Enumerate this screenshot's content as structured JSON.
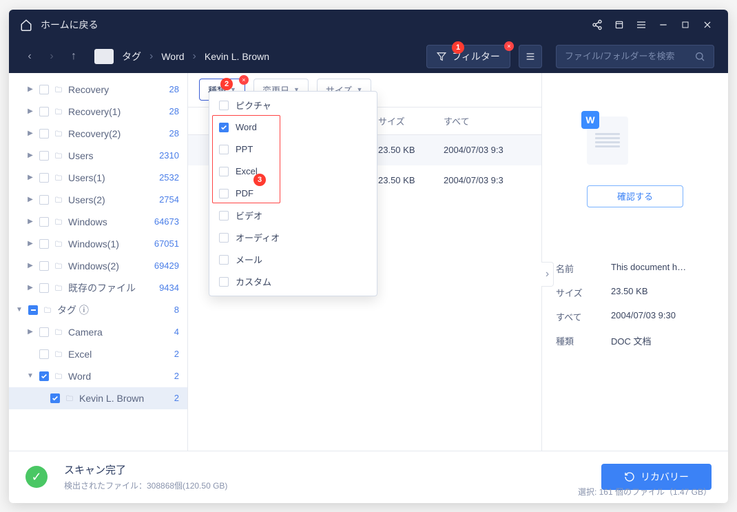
{
  "titlebar": {
    "home_label": "ホームに戻る"
  },
  "breadcrumb": {
    "tag": "タグ",
    "word": "Word",
    "person": "Kevin L. Brown"
  },
  "toolbar": {
    "filter_label": "フィルター",
    "search_placeholder": "ファイル/フォルダーを検索"
  },
  "filter_buttons": {
    "type": "種類",
    "date": "変更日",
    "size": "サイズ"
  },
  "sidebar": {
    "items": [
      {
        "label": "Recovery",
        "count": "28",
        "depth": 1,
        "caret": "right",
        "chk": ""
      },
      {
        "label": "Recovery(1)",
        "count": "28",
        "depth": 1,
        "caret": "right",
        "chk": ""
      },
      {
        "label": "Recovery(2)",
        "count": "28",
        "depth": 1,
        "caret": "right",
        "chk": ""
      },
      {
        "label": "Users",
        "count": "2310",
        "depth": 1,
        "caret": "right",
        "chk": ""
      },
      {
        "label": "Users(1)",
        "count": "2532",
        "depth": 1,
        "caret": "right",
        "chk": ""
      },
      {
        "label": "Users(2)",
        "count": "2754",
        "depth": 1,
        "caret": "right",
        "chk": ""
      },
      {
        "label": "Windows",
        "count": "64673",
        "depth": 1,
        "caret": "right",
        "chk": ""
      },
      {
        "label": "Windows(1)",
        "count": "67051",
        "depth": 1,
        "caret": "right",
        "chk": ""
      },
      {
        "label": "Windows(2)",
        "count": "69429",
        "depth": 1,
        "caret": "right",
        "chk": ""
      },
      {
        "label": "既存のファイル",
        "count": "9434",
        "depth": 1,
        "caret": "right",
        "chk": ""
      },
      {
        "label": "タグ ⓘ",
        "count": "8",
        "depth": 0,
        "caret": "down",
        "chk": "partial"
      },
      {
        "label": "Camera",
        "count": "4",
        "depth": 1,
        "caret": "right",
        "chk": ""
      },
      {
        "label": "Excel",
        "count": "2",
        "depth": 1,
        "caret": "",
        "chk": ""
      },
      {
        "label": "Word",
        "count": "2",
        "depth": 1,
        "caret": "down",
        "chk": "checked"
      },
      {
        "label": "Kevin L. Brown",
        "count": "2",
        "depth": 2,
        "caret": "",
        "chk": "checked",
        "active": true
      }
    ]
  },
  "table": {
    "headers": {
      "c1": "",
      "c2": "サイズ",
      "c3": "すべて"
    },
    "rows": [
      {
        "size": "23.50 KB",
        "date": "2004/07/03 9:3"
      },
      {
        "size": "23.50 KB",
        "date": "2004/07/03 9:3"
      }
    ]
  },
  "dropdown": {
    "items": [
      {
        "label": "ピクチャ",
        "checked": false
      },
      {
        "label": "Word",
        "checked": true
      },
      {
        "label": "PPT",
        "checked": false
      },
      {
        "label": "Excel",
        "checked": false
      },
      {
        "label": "PDF",
        "checked": false
      },
      {
        "label": "ビデオ",
        "checked": false
      },
      {
        "label": "オーディオ",
        "checked": false
      },
      {
        "label": "メール",
        "checked": false
      },
      {
        "label": "カスタム",
        "checked": false
      }
    ]
  },
  "preview": {
    "confirm_label": "確認する",
    "meta": {
      "name_k": "名前",
      "name_v": "This document h…",
      "size_k": "サイズ",
      "size_v": "23.50 KB",
      "all_k": "すべて",
      "all_v": "2004/07/03 9:30",
      "type_k": "種類",
      "type_v": "DOC 文档"
    }
  },
  "footer": {
    "status_line1": "スキャン完了",
    "status_line2": "検出されたファイル：308868個(120.50 GB)",
    "recover_label": "リカバリー",
    "selection_label": "選択: 161 個のファイル（1.47 GB）"
  },
  "annotations": {
    "a1": "1",
    "a2": "2",
    "a3": "3"
  }
}
